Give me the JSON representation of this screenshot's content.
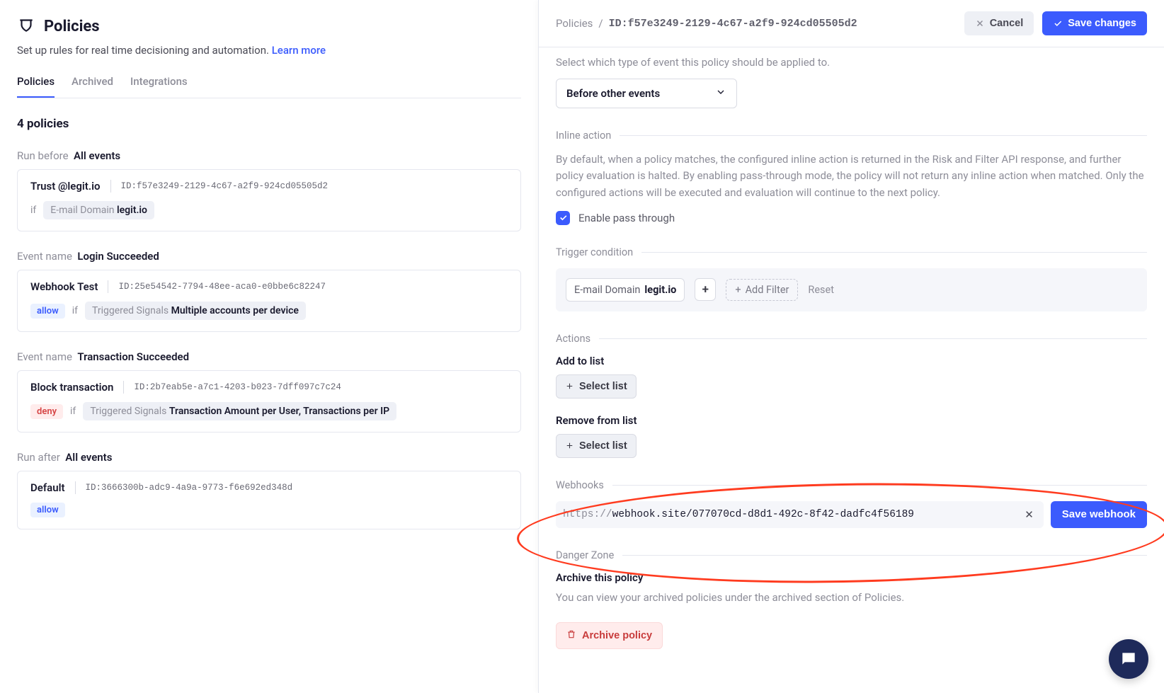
{
  "header": {
    "title": "Policies",
    "subtitle": "Set up rules for real time decisioning and automation.",
    "learn_more": "Learn more"
  },
  "tabs": [
    {
      "label": "Policies",
      "active": true
    },
    {
      "label": "Archived",
      "active": false
    },
    {
      "label": "Integrations",
      "active": false
    }
  ],
  "count_heading": "4 policies",
  "groups": [
    {
      "prefix": "Run before",
      "label": "All events",
      "cards": [
        {
          "name": "Trust @legit.io",
          "id": "ID:f57e3249-2129-4c67-a2f9-924cd05505d2",
          "badge": null,
          "if": "if",
          "chip_prefix": "E-mail Domain",
          "chip_value": "legit.io"
        }
      ]
    },
    {
      "prefix": "Event name",
      "label": "Login Succeeded",
      "cards": [
        {
          "name": "Webhook Test",
          "id": "ID:25e54542-7794-48ee-aca0-e0bbe6c82247",
          "badge": "allow",
          "if": "if",
          "chip_prefix": "Triggered Signals",
          "chip_value": "Multiple accounts per device"
        }
      ]
    },
    {
      "prefix": "Event name",
      "label": "Transaction Succeeded",
      "cards": [
        {
          "name": "Block transaction",
          "id": "ID:2b7eab5e-a7c1-4203-b023-7dff097c7c24",
          "badge": "deny",
          "if": "if",
          "chip_prefix": "Triggered Signals",
          "chip_value": "Transaction Amount per User, Transactions per IP"
        }
      ]
    },
    {
      "prefix": "Run after",
      "label": "All events",
      "cards": [
        {
          "name": "Default",
          "id": "ID:3666300b-adc9-4a9a-9773-f6e692ed348d",
          "badge": "allow",
          "if": null,
          "chip_prefix": null,
          "chip_value": null
        }
      ]
    }
  ],
  "drawer": {
    "breadcrumb_root": "Policies",
    "breadcrumb_sep": "/",
    "breadcrumb_id": "ID:f57e3249-2129-4c67-a2f9-924cd05505d2",
    "cancel": "Cancel",
    "save": "Save changes",
    "event_desc": "Select which type of event this policy should be applied to.",
    "event_select": "Before other events",
    "inline_action_title": "Inline action",
    "inline_action_desc": "By default, when a policy matches, the configured inline action is returned in the Risk and Filter API response, and further policy evaluation is halted. By enabling pass-through mode, the policy will not return any inline action when matched. Only the configured actions will be executed and evaluation will continue to the next policy.",
    "pass_through_label": "Enable pass through",
    "trigger_title": "Trigger condition",
    "trigger_chip_prefix": "E-mail Domain",
    "trigger_chip_value": "legit.io",
    "add_filter": "Add Filter",
    "reset": "Reset",
    "actions_title": "Actions",
    "add_to_list": "Add to list",
    "select_list": "Select list",
    "remove_from_list": "Remove from list",
    "webhooks_title": "Webhooks",
    "webhook_prefix": "https://",
    "webhook_value": "webhook.site/077070cd-d8d1-492c-8f42-dadfc4f56189",
    "save_webhook": "Save webhook",
    "danger_title": "Danger Zone",
    "archive_heading": "Archive this policy",
    "archive_desc": "You can view your archived policies under the archived section of Policies.",
    "archive_btn": "Archive policy"
  }
}
